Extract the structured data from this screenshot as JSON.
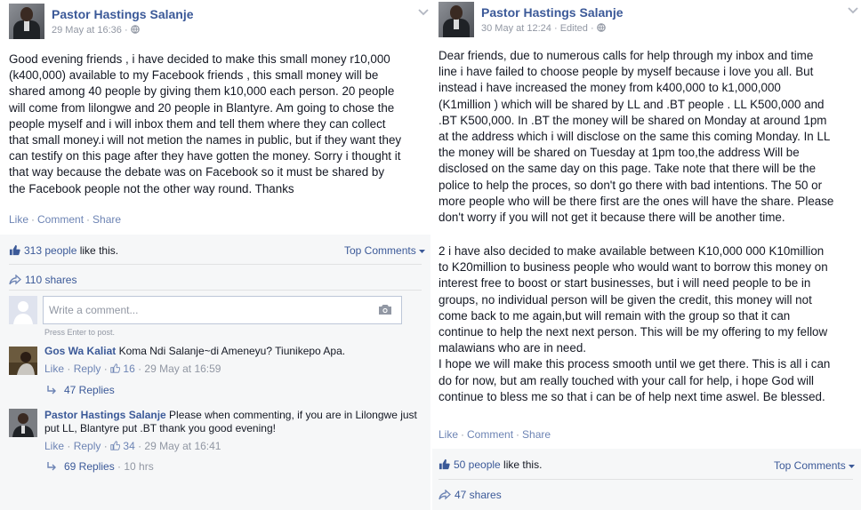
{
  "left_post": {
    "author": "Pastor Hastings Salanje",
    "timestamp": "29 May at 16:36",
    "meta_separator": "·",
    "body": "Good evening friends , i have decided to make this small money r10,000\n(k400,000) available to my Facebook friends , this small money will be\nshared among 40 people by giving them k10,000 each person. 20 people\nwill come from lilongwe and 20 people in Blantyre. Am going to chose the\npeople myself and i will inbox them and tell them where they can collect\nthat small money.i will not metion the names in public, but if they want they\ncan testify on this page after they have gotten the money. Sorry i thought it\nthat way because the debate was on Facebook so it must be shared by\nthe Facebook people not the other way round. Thanks",
    "actions": {
      "like": "Like",
      "comment": "Comment",
      "share": "Share",
      "dot": "·"
    },
    "likes_count": "313 people",
    "likes_suffix": " like this.",
    "top_comments": "Top Comments",
    "shares": "110 shares",
    "comment_placeholder": "Write a comment...",
    "press_enter": "Press Enter to post.",
    "comments": [
      {
        "name": "Gos Wa Kaliat",
        "text": " Koma Ndi Salanje~di Ameneyu? Tiunikepo Apa.",
        "like": "Like",
        "reply": "Reply",
        "like_count": "16",
        "time": "29 May at 16:59",
        "replies": "47 Replies"
      },
      {
        "name": "Pastor Hastings Salanje",
        "text": " Please when commenting, if you are in Lilongwe just put LL, Blantyre put .BT thank you good evening!",
        "like": "Like",
        "reply": "Reply",
        "like_count": "34",
        "time": "29 May at 16:41",
        "replies": "69 Replies",
        "replies_time": "10 hrs"
      }
    ]
  },
  "right_post": {
    "author": "Pastor Hastings Salanje",
    "timestamp": "30 May at 12:24",
    "edited": "Edited",
    "meta_separator": "·",
    "body": "Dear friends, due to numerous calls for help through my inbox and time\nline i have failed to choose people by myself because i love you all. But\ninstead i have increased the money from k400,000 to k1,000,000\n(K1million ) which will be shared by LL and .BT people . LL K500,000 and\n.BT K500,000. In .BT the money will be shared on Monday at around 1pm\nat the address which i will disclose on the same this coming Monday. In LL\nthe money will be shared on Tuesday at 1pm too,the address Will be\ndisclosed on the same day on this page. Take note that there will be the\npolice to help the proces, so don't go there with bad intentions. The 50 or\nmore people who will be there first are the ones will have the share. Please\ndon't worry if you will not get it because there will be another time.",
    "body2": "2 i have also decided to make available between K10,000 000 K10million\nto K20million to business people who would want to borrow this money on\ninterest free to boost or start businesses, but i will need people to be in\ngroups, no individual person will be given the credit, this money will not\ncome back to me again,but will remain with the group so that it can\ncontinue to help the next next person. This will be my offering to my fellow\nmalawians who are in need.\nI hope we will make this process smooth until we get there. This is all i can\ndo for now, but am really touched with your call for help, i hope God will\ncontinue to bless me so that i can be of help next time aswel. Be blessed.",
    "actions": {
      "like": "Like",
      "comment": "Comment",
      "share": "Share",
      "dot": "·"
    },
    "likes_count": "50 people",
    "likes_suffix": " like this.",
    "top_comments": "Top Comments",
    "shares": "47 shares"
  },
  "colors": {
    "link": "#3b5998",
    "action": "#6d84b4",
    "muted": "#9197a3",
    "ufi_bg": "#f6f7f8"
  },
  "icons": [
    "globe-icon",
    "chevron-down-icon",
    "thumbs-up-icon",
    "share-arrow-icon",
    "camera-icon",
    "reply-arrow-icon"
  ]
}
